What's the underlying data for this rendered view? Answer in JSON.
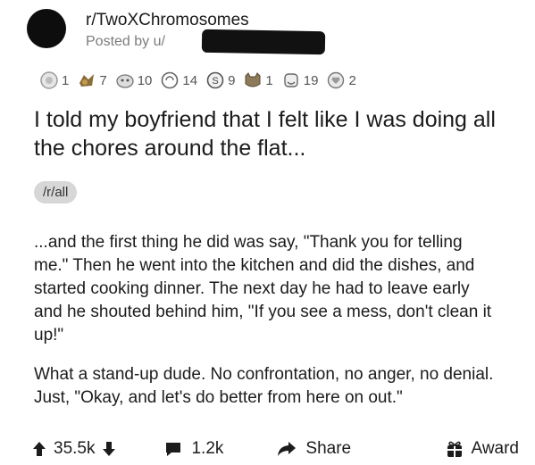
{
  "post": {
    "subreddit": "r/TwoXChromosomes",
    "posted_by": "Posted by u/",
    "awards": [
      {
        "icon": "silver-award-icon",
        "count": "1"
      },
      {
        "icon": "gold-award-icon",
        "count": "7"
      },
      {
        "icon": "wholesome-award-icon",
        "count": "10"
      },
      {
        "icon": "helpful-award-icon",
        "count": "14"
      },
      {
        "icon": "coin-award-icon",
        "count": "9"
      },
      {
        "icon": "cat-award-icon",
        "count": "1"
      },
      {
        "icon": "hug-award-icon",
        "count": "19"
      },
      {
        "icon": "heart-award-icon",
        "count": "2"
      }
    ],
    "title": "I told my boyfriend that I felt like I was doing all the chores around the flat...",
    "flair": "/r/all",
    "body": [
      "...and the first thing he did was say, \"Thank you for telling me.\" Then he went into the kitchen and did the dishes, and started cooking dinner.  The next day he had to leave early and he shouted behind him, \"If you see a mess, don't clean it up!\"",
      "What a stand-up dude. No confrontation, no anger, no denial. Just, \"Okay, and let's do better from here on out.\""
    ]
  },
  "actions": {
    "upvotes": "35.5k",
    "comments": "1.2k",
    "share_label": "Share",
    "award_label": "Award"
  }
}
